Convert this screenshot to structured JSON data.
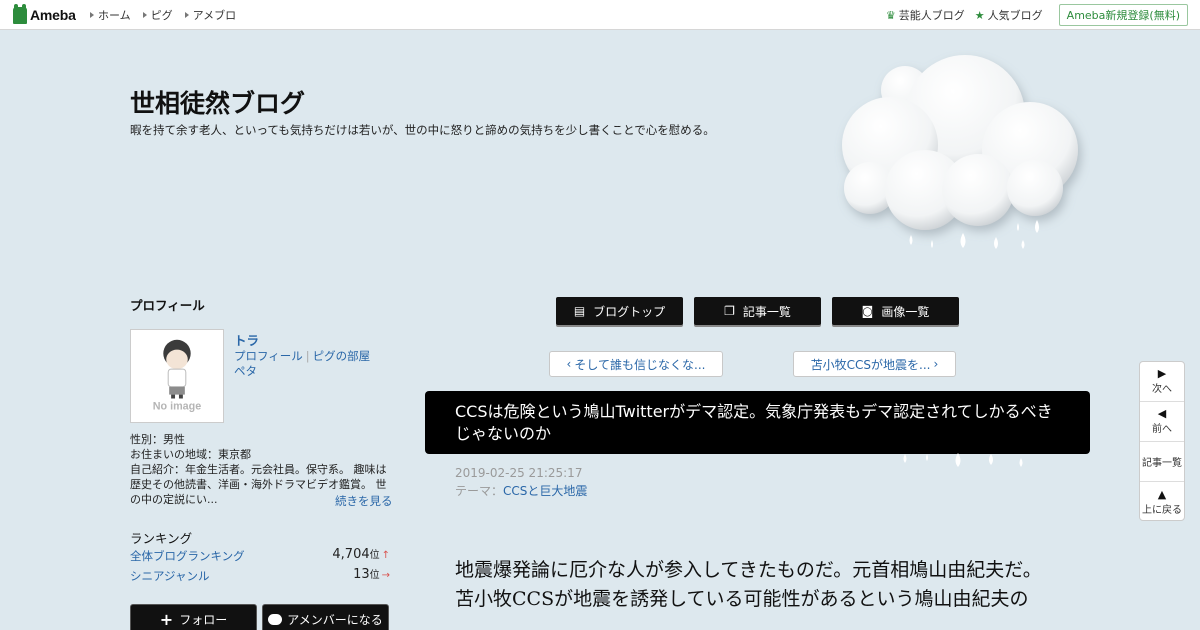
{
  "topbar": {
    "logo": "Ameba",
    "nav": [
      "ホーム",
      "ピグ",
      "アメブロ"
    ],
    "right_links": [
      {
        "label": "芸能人ブログ",
        "icon": "crown-icon"
      },
      {
        "label": "人気ブログ",
        "icon": "star-icon"
      }
    ],
    "register": "Ameba新規登録(無料)"
  },
  "header": {
    "title": "世相徒然ブログ",
    "description": "暇を持て余す老人、といっても気持ちだけは若いが、世の中に怒りと諦めの気持ちを少し書くことで心を慰める。"
  },
  "sidebar": {
    "heading": "プロフィール",
    "avatar_text": "No image",
    "name": "トラ",
    "links": [
      "プロフィール",
      "ピグの部屋",
      "ペタ"
    ],
    "info": [
      "性別：男性",
      "お住まいの地域：東京都",
      "自己紹介：年金生活者。元会社員。保守系。 趣味は歴史その他読書、洋画・海外ドラマビデオ鑑賞。 世の中の定説にい..."
    ],
    "more": "続きを見る",
    "ranking": {
      "title": "ランキング",
      "rows": [
        {
          "label": "全体ブログランキング",
          "value": "4,704",
          "unit": "位",
          "trend": "↑"
        },
        {
          "label": "シニアジャンル",
          "value": "13",
          "unit": "位",
          "trend": "→"
        }
      ]
    },
    "buttons": [
      "フォロー",
      "アメンバーになる"
    ]
  },
  "main": {
    "buttons": [
      "ブログトップ",
      "記事一覧",
      "画像一覧"
    ],
    "prev_entry": "そして誰も信じなくな...",
    "next_entry": "苫小牧CCSが地震を...",
    "entry_title": "CCSは危険という鳩山Twitterがデマ認定。気象庁発表もデマ認定されてしかるべきじゃないのか",
    "date": "2019-02-25 21:25:17",
    "theme_label": "テーマ：",
    "theme": "CCSと巨大地震",
    "body": [
      "地震爆発論に厄介な人が参入してきたものだ。元首相鳩山由紀夫だ。",
      "苫小牧CCSが地震を誘発している可能性があるという鳩山由紀夫の"
    ]
  },
  "floatnav": [
    "次へ",
    "前へ",
    "記事一覧",
    "上に戻る"
  ],
  "colors": {
    "background": "#dde8ee",
    "accent": "#2d8c3c",
    "link": "#2a67a8"
  }
}
